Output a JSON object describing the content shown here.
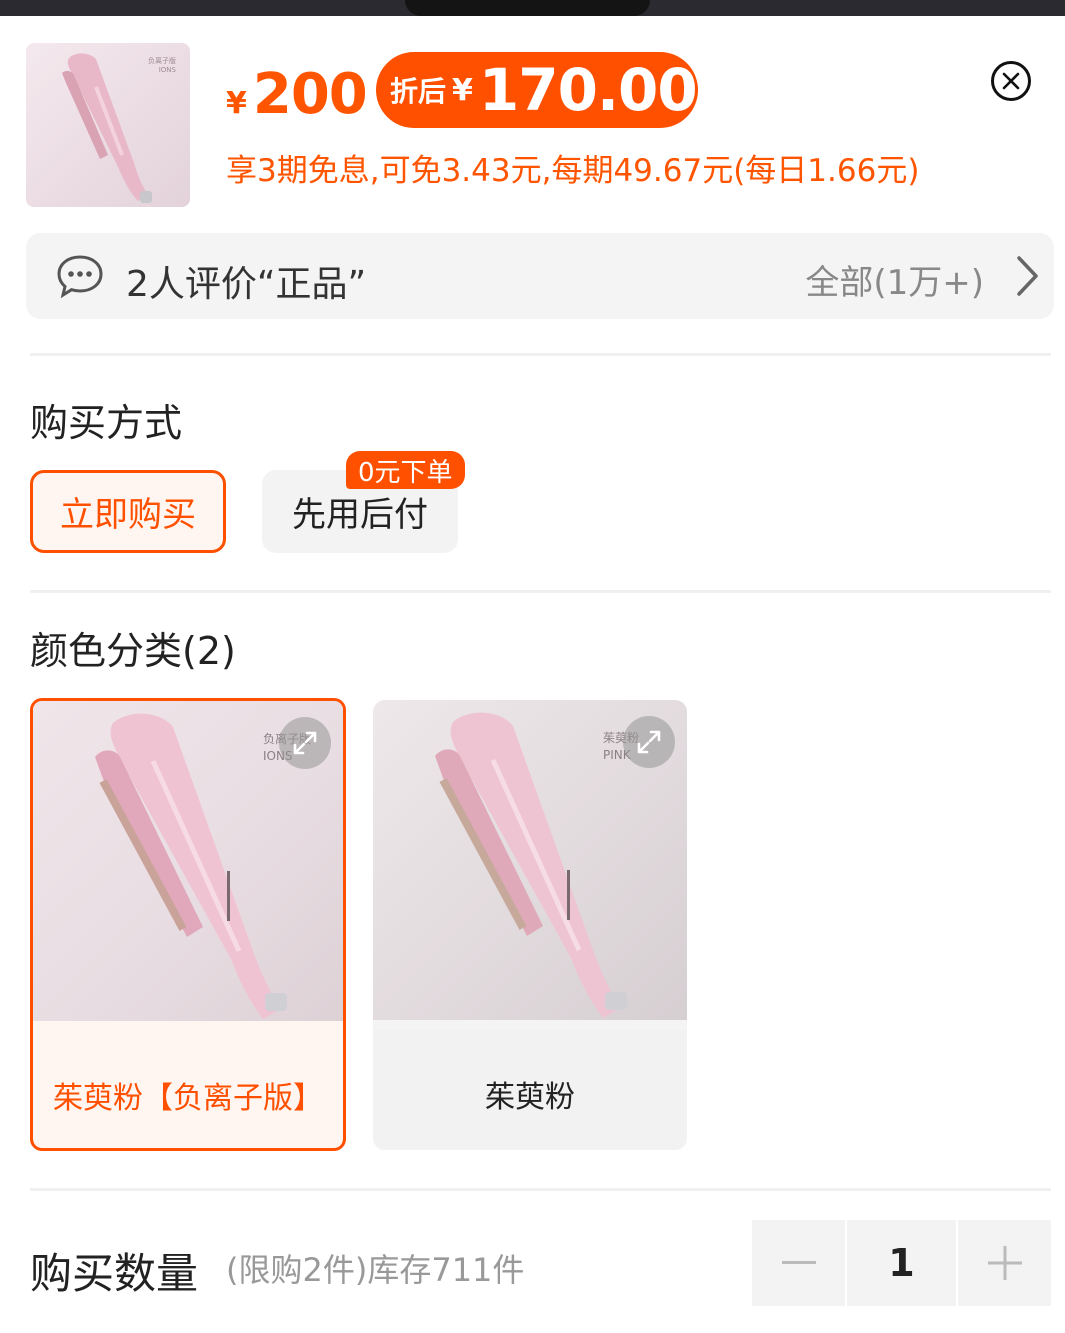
{
  "price": {
    "currency": "¥",
    "original": "200",
    "after_label": "折后",
    "after_currency": "¥",
    "after_value": "170.00",
    "installment": "享3期免息,可免3.43元,每期49.67元(每日1.66元)"
  },
  "thumbnail": {
    "brand_line1": "负离子版",
    "brand_line2": "IONS"
  },
  "review": {
    "text": "2人评价“正品”",
    "all_text": "全部(1万+)"
  },
  "purchase_method": {
    "title": "购买方式",
    "options": [
      {
        "label": "立即购买",
        "selected": true
      },
      {
        "label": "先用后付",
        "selected": false,
        "badge": "0元下单"
      }
    ]
  },
  "colors": {
    "title": "颜色分类(2)",
    "items": [
      {
        "label": "茱萸粉【负离子版】",
        "img_text1": "负离子版",
        "img_text2": "IONS",
        "selected": true
      },
      {
        "label": "茱萸粉",
        "img_text1": "茱萸粉",
        "img_text2": "PINK",
        "selected": false
      }
    ]
  },
  "quantity": {
    "title": "购买数量",
    "limit_text": "(限购2件)库存711件",
    "value": "1"
  },
  "colors_theme": {
    "accent": "#ff5000",
    "text": "#222222",
    "muted": "#999999"
  }
}
